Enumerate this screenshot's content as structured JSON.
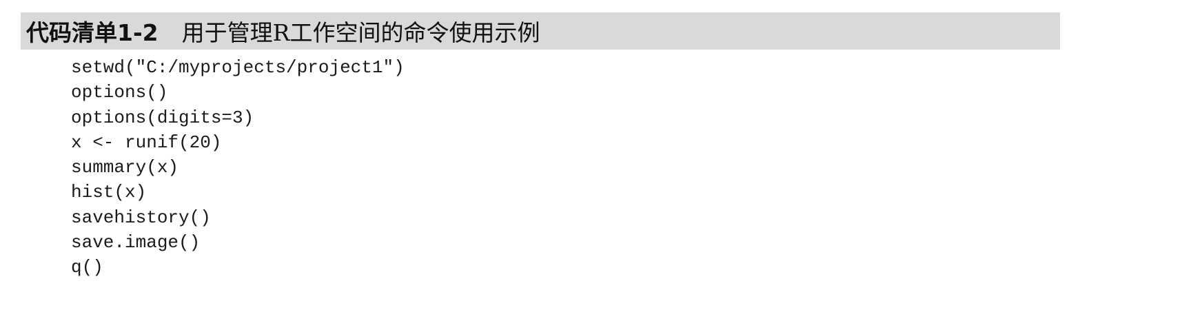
{
  "listing": {
    "label": "代码清单1-2",
    "title": "用于管理R工作空间的命令使用示例"
  },
  "code_lines": [
    "setwd(\"C:/myprojects/project1\")",
    "options()",
    "options(digits=3)",
    "x <- runif(20)",
    "summary(x)",
    "hist(x)",
    "savehistory()",
    "save.image()",
    "q()"
  ]
}
